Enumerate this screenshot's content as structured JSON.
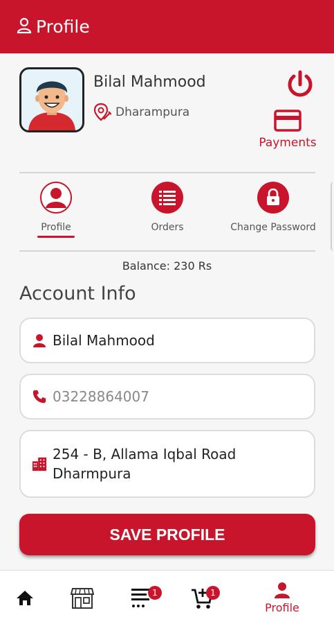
{
  "appbar": {
    "title": "Profile",
    "icon": "person-outline-icon"
  },
  "user": {
    "name": "Bilal Mahmood",
    "location": "Dharampura"
  },
  "actions": {
    "payments_label": "Payments",
    "logout_icon": "power-icon"
  },
  "tabs": [
    {
      "label": "Profile",
      "icon": "person-circle-icon",
      "active": true
    },
    {
      "label": "Orders",
      "icon": "list-icon",
      "active": false
    },
    {
      "label": "Change Password",
      "icon": "lock-icon",
      "active": false
    }
  ],
  "balance": "Balance: 230 Rs",
  "account": {
    "title": "Account Info",
    "name_value": "Bilal Mahmood",
    "phone_placeholder": "03228864007",
    "address_value": "254 - B, Allama Iqbal Road\nDharmpura"
  },
  "save_label": "SAVE PROFILE",
  "bottom_nav": {
    "items": [
      {
        "icon": "home-icon"
      },
      {
        "icon": "store-icon"
      },
      {
        "icon": "menu-list-icon",
        "badge": "1"
      },
      {
        "icon": "cart-icon",
        "badge": "1"
      },
      {
        "icon": "person-icon",
        "label": "Profile"
      }
    ]
  },
  "colors": {
    "primary": "#c8152b",
    "background": "#f6f6f6"
  }
}
